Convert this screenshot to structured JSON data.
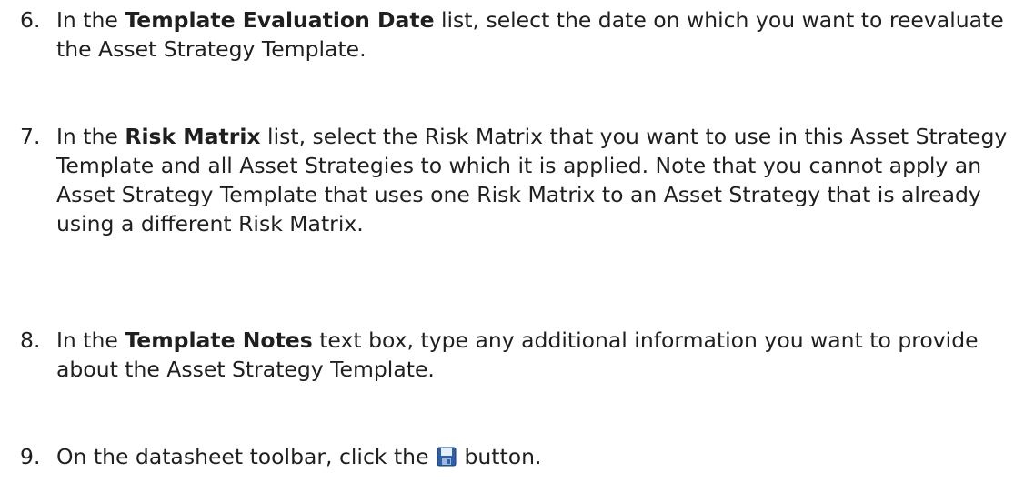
{
  "steps": [
    {
      "number": "6.",
      "prefix": "In the ",
      "bold": "Template Evaluation Date",
      "suffix": " list, select the date on which you want to reevaluate the Asset Strategy Template."
    },
    {
      "number": "7.",
      "prefix": "In the ",
      "bold": "Risk Matrix",
      "suffix": " list, select the Risk Matrix that you want to use in this Asset Strategy Template and all Asset Strategies to which it is applied. Note that you cannot apply an Asset Strategy Template that uses one Risk Matrix to an Asset Strategy that is already using a different Risk Matrix."
    },
    {
      "number": "8.",
      "prefix": "In the ",
      "bold": "Template Notes",
      "suffix": " text box, type any additional information you want to provide about the Asset Strategy Template."
    },
    {
      "number": "9.",
      "prefix": "On the datasheet toolbar, click the ",
      "icon": "save-icon",
      "suffix": " button."
    }
  ],
  "colors": {
    "text": "#1f1f1f",
    "icon_body": "#2f5fa8",
    "icon_label": "#e8eef8"
  }
}
